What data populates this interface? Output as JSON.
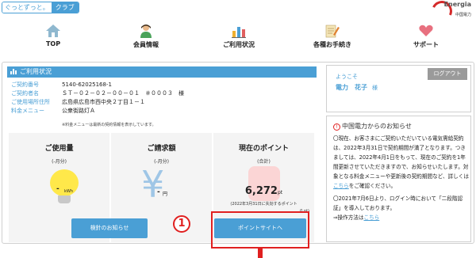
{
  "header": {
    "logo_left": "ぐっとずっと。",
    "logo_right": "クラブ",
    "brand_name": "Energia",
    "brand_sub": "中国電力"
  },
  "nav": {
    "items": [
      {
        "label": "TOP",
        "icon": "home-icon"
      },
      {
        "label": "会員情報",
        "icon": "person-icon"
      },
      {
        "label": "ご利用状況",
        "icon": "bar-chart-icon"
      },
      {
        "label": "各種お手続き",
        "icon": "document-pen-icon"
      },
      {
        "label": "サポート",
        "icon": "heart-icon"
      }
    ]
  },
  "usage": {
    "section_title": "ご利用状況",
    "contract_no_label": "ご契約番号",
    "contract_no": "5140-62025168-1",
    "contract_name_label": "ご契約者名",
    "contract_name": "ＳＴ－０２－０２－００－０１　＃０００３　様",
    "address_label": "ご使用場所住所",
    "address": "広島県広島市西中央２丁目１－１",
    "plan_label": "料金メニュー",
    "plan": "公衆街路灯Ａ",
    "plan_note": "※料金メニューは最新の契約情報を表示しています。"
  },
  "cards": {
    "usage_title": "ご使用量",
    "usage_sub": "(-月分)",
    "usage_value": "-",
    "usage_unit": "kWh",
    "bill_title": "ご請求額",
    "bill_sub": "(-月分)",
    "bill_value": "-",
    "bill_unit": "円",
    "points_title": "現在のポイント",
    "points_sub": "(合計)",
    "points_value": "6,272",
    "points_unit": "pt",
    "points_note": "(2022年3月31日に失効するポイント",
    "points_expiring": "0 pt)"
  },
  "buttons": {
    "checklist": "検針のお知らせ",
    "point_site": "ポイントサイトへ"
  },
  "callout_number": "1",
  "welcome": {
    "greeting": "ようこそ",
    "name": "電力　花子",
    "honorific": "様",
    "logout": "ログアウト"
  },
  "news": {
    "title": "中国電力からのお知らせ",
    "p1": "〇現在、お客さまにご契約いただいている電気需給契約は、2022年3月31日で契約期間が満了となります。つきましては、2022年4月1日をもって、現在のご契約を1年間更新させていただきますので、お知らせいたします。対象となる料金メニューや更新後の契約期間など、詳しくは",
    "p1_link": "こちら",
    "p1_tail": "をご確認ください。",
    "p2": "〇2021年7月6日より、ログイン時において「二段階認証」を導入しております。",
    "p3": "⇒操作方法は",
    "p3_link": "こちら"
  },
  "colors": {
    "accent": "#4a9fd5",
    "highlight": "#e02020",
    "logout_bg": "#9a9a9a"
  }
}
